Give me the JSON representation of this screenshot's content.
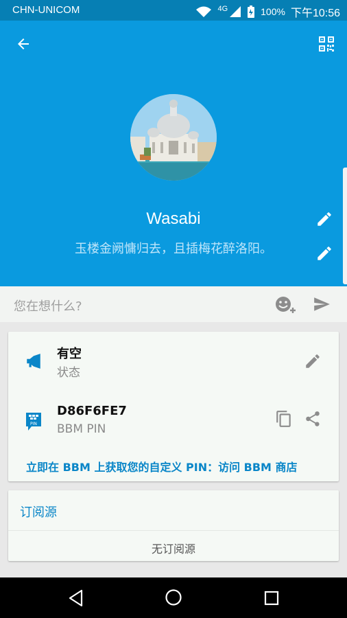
{
  "status_bar": {
    "carrier": "CHN-UNICOM",
    "network": "4G",
    "battery": "100%",
    "time": "下午10:56"
  },
  "header": {
    "back_icon": "arrow-left-icon",
    "qr_icon": "qr-code-icon",
    "name": "Wasabi",
    "motto": "玉楼金阙慵归去，且插梅花醉洛阳。",
    "edit_icon": "pencil-icon"
  },
  "post": {
    "placeholder": "您在想什么?",
    "emoji_icon": "emoji-add-icon",
    "send_icon": "send-icon"
  },
  "profile_card": {
    "status_title": "有空",
    "status_label": "状态",
    "pin_value": "D86F6FE7",
    "pin_label": "BBM PIN",
    "pin_icon_text": "PIN",
    "custom_pin_link": "立即在 BBM 上获取您的自定义 PIN：访问 BBM 商店"
  },
  "feeds_card": {
    "title": "订阅源",
    "empty": "无订阅源"
  },
  "colors": {
    "header_bg": "#0A9ADF",
    "status_bg": "#067FB4",
    "accent": "#0A86C8"
  }
}
